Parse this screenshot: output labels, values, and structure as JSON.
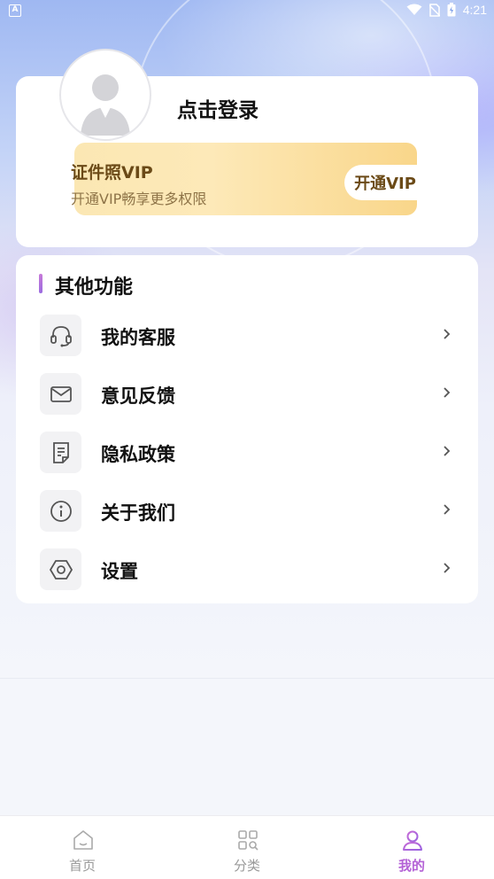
{
  "status_bar": {
    "left_badge": "A",
    "time": "4:21"
  },
  "profile": {
    "login_text": "点击登录"
  },
  "vip": {
    "title": "证件照VIP",
    "subtitle": "开通VIP畅享更多权限",
    "button": "开通VIP"
  },
  "features": {
    "title": "其他功能",
    "items": [
      {
        "label": "我的客服",
        "icon": "headset-icon"
      },
      {
        "label": "意见反馈",
        "icon": "mail-icon"
      },
      {
        "label": "隐私政策",
        "icon": "document-icon"
      },
      {
        "label": "关于我们",
        "icon": "info-icon"
      },
      {
        "label": "设置",
        "icon": "settings-icon"
      }
    ]
  },
  "bottom_nav": {
    "items": [
      {
        "label": "首页",
        "icon": "home-icon",
        "active": false
      },
      {
        "label": "分类",
        "icon": "category-icon",
        "active": false
      },
      {
        "label": "我的",
        "icon": "user-icon",
        "active": true
      }
    ]
  },
  "colors": {
    "accent": "#b462d6",
    "vip_text": "#6b4a17"
  }
}
